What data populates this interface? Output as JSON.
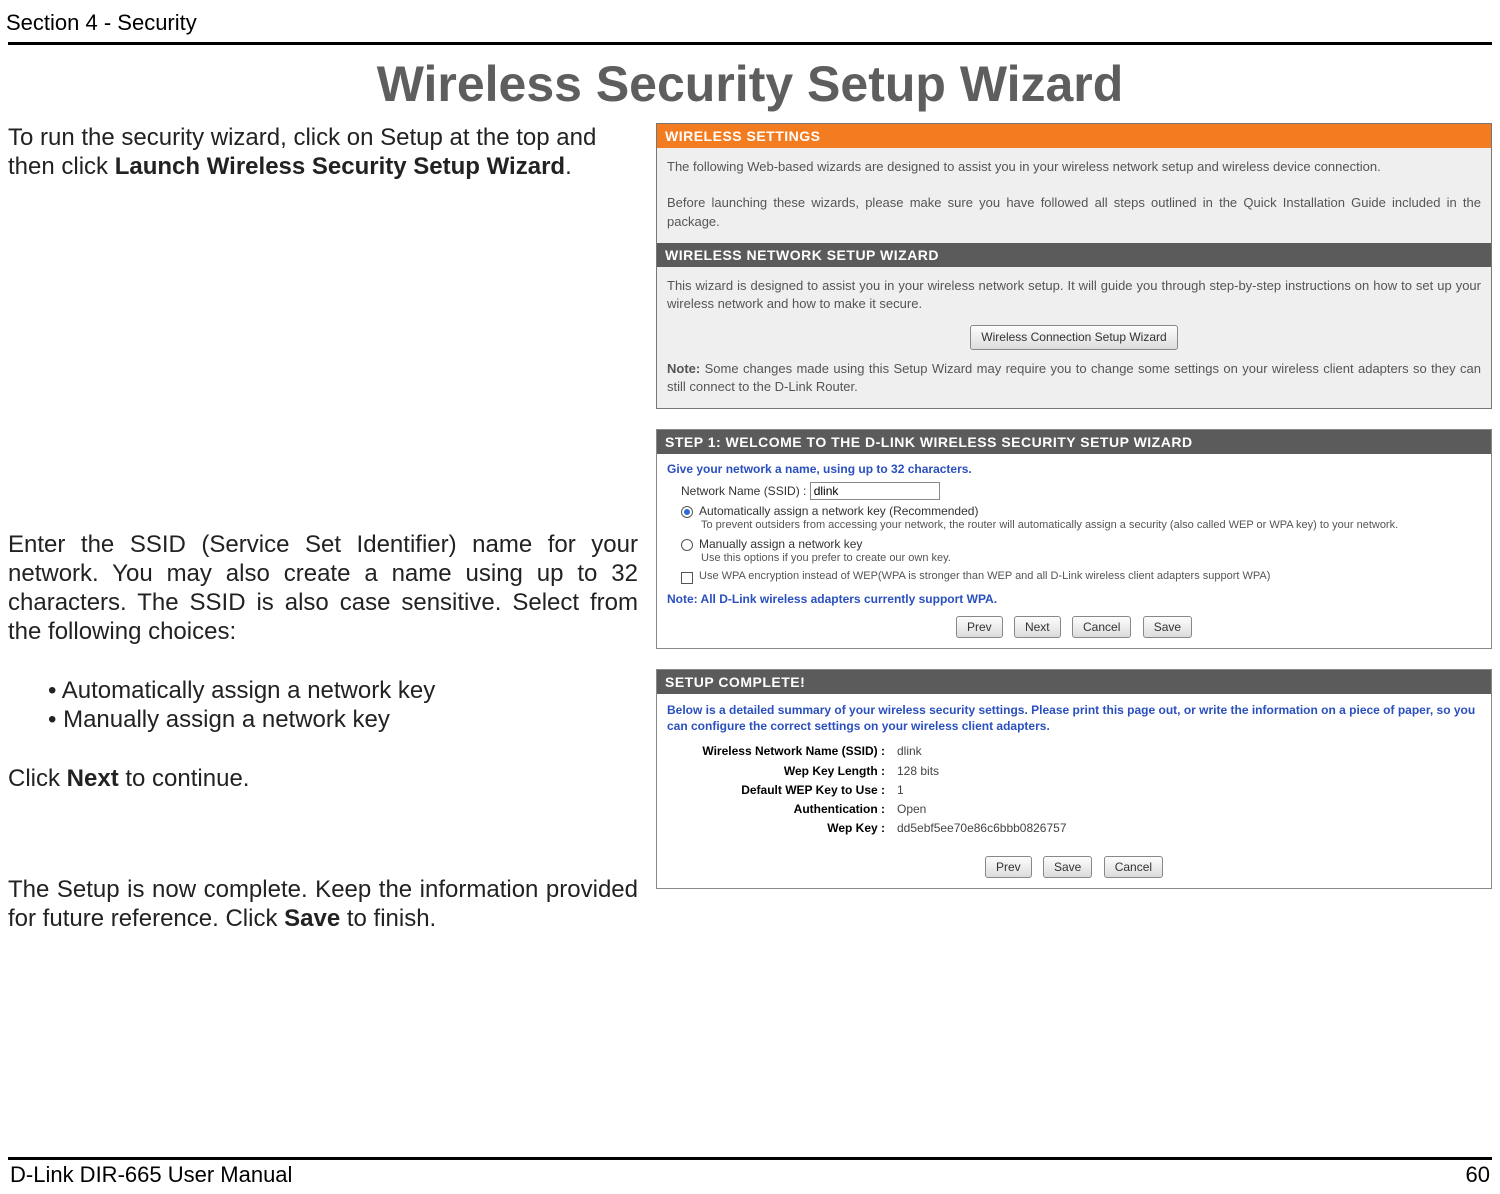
{
  "page": {
    "section": "Section 4 - Security",
    "title": "Wireless Security Setup Wizard",
    "footer_left": "D-Link DIR-665 User Manual",
    "footer_right": "60"
  },
  "left": {
    "p1a": "To run the security wizard, click on Setup at the top and then click ",
    "p1b": "Launch Wireless Security Setup Wizard",
    "p1c": ".",
    "p2": "Enter the SSID (Service Set Identifier) name for your network. You may also create a name using up to 32 characters. The SSID is also case sensitive. Select from the following choices:",
    "b1": "• Automatically assign a network key",
    "b2": "• Manually assign a network key",
    "p3a": "Click ",
    "p3b": "Next",
    "p3c": " to continue.",
    "p4a": "The Setup is now complete. Keep the information provided for future reference. Click ",
    "p4b": "Save",
    "p4c": " to finish."
  },
  "panel1": {
    "header": "WIRELESS SETTINGS",
    "para1": "The following Web-based wizards are designed to assist you in your wireless network setup and wireless device connection.",
    "para2": "Before launching these wizards, please make sure you have followed all steps outlined in the Quick Installation Guide included in the package.",
    "sub_header": "WIRELESS NETWORK SETUP WIZARD",
    "para3": "This wizard is designed to assist you in your wireless network setup. It will guide you through step-by-step instructions on how to set up your wireless network and how to make it secure.",
    "button": "Wireless Connection Setup Wizard",
    "note_label": "Note:",
    "note_text": " Some changes made using this Setup Wizard may require you to change some settings on your wireless client adapters so they can still connect to the D-Link Router."
  },
  "panel2": {
    "header": "STEP 1: WELCOME TO THE D-LINK WIRELESS SECURITY SETUP WIZARD",
    "intro": "Give your network a name, using up to 32 characters.",
    "ssid_label": "Network Name (SSID) :",
    "ssid_value": "dlink",
    "opt1": "Automatically assign a network key (Recommended)",
    "opt1_desc": "To prevent outsiders from accessing your network, the router will automatically assign a security (also called WEP or WPA key) to your network.",
    "opt2": "Manually assign a network key",
    "opt2_desc": "Use this options if you prefer to create our own key.",
    "chk_desc": "Use WPA encryption instead of WEP(WPA is stronger than WEP and all D-Link wireless client adapters support WPA)",
    "note": "Note: All D-Link wireless adapters currently support WPA.",
    "btn_prev": "Prev",
    "btn_next": "Next",
    "btn_cancel": "Cancel",
    "btn_save": "Save"
  },
  "panel3": {
    "header": "SETUP COMPLETE!",
    "intro": "Below is a detailed summary of your wireless security settings. Please print this page out, or write the information on a piece of paper, so you can configure the correct settings on your wireless client adapters.",
    "rows": {
      "r1l": "Wireless Network Name (SSID) :",
      "r1v": "dlink",
      "r2l": "Wep Key Length :",
      "r2v": "128 bits",
      "r3l": "Default WEP Key to Use :",
      "r3v": "1",
      "r4l": "Authentication :",
      "r4v": "Open",
      "r5l": "Wep Key :",
      "r5v": "dd5ebf5ee70e86c6bbb0826757"
    },
    "btn_prev": "Prev",
    "btn_save": "Save",
    "btn_cancel": "Cancel"
  }
}
